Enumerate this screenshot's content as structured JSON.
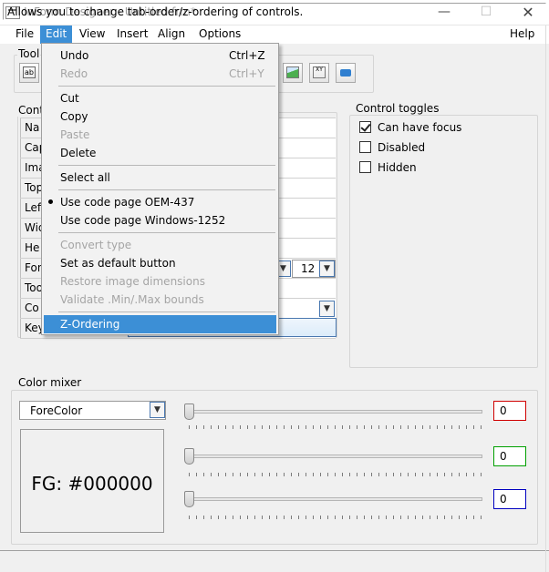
{
  "window": {
    "title": "InForm Designer - Untitled.frm*",
    "minimize_glyph": "—",
    "maximize_glyph": "☐",
    "close_glyph": "✕",
    "icon": "app-window-icon"
  },
  "menubar": [
    "File",
    "Edit",
    "View",
    "Insert",
    "Align",
    "Options",
    "Help"
  ],
  "toolbox": {
    "legend": "Tool",
    "label_tool_text": "ab",
    "frame_tool_text": "XY"
  },
  "control_props": {
    "legend": "Cont",
    "rows": [
      "Na",
      "Cap",
      "Ima",
      "Top",
      "Left",
      "Wid",
      "He",
      "Fon",
      "Too",
      "Co",
      "Key"
    ],
    "font_size": "12"
  },
  "control_toggles": {
    "legend": "Control toggles",
    "items": [
      {
        "label": "Can have focus",
        "checked": true
      },
      {
        "label": "Disabled",
        "checked": false
      },
      {
        "label": "Hidden",
        "checked": false
      }
    ]
  },
  "color_mixer": {
    "legend": "Color mixer",
    "target": "ForeColor",
    "preview": "FG: #000000",
    "red": "0",
    "green": "0",
    "blue": "0",
    "red_level": 0,
    "green_level": 0,
    "blue_level": 0,
    "colors": {
      "red": "#d00000",
      "green": "#00a000",
      "blue": "#0000c0"
    }
  },
  "edit_menu": {
    "items": [
      {
        "label": "Undo",
        "shortcut": "Ctrl+Z",
        "enabled": true
      },
      {
        "label": "Redo",
        "shortcut": "Ctrl+Y",
        "enabled": false
      },
      {
        "label": "Cut",
        "enabled": true
      },
      {
        "label": "Copy",
        "enabled": true
      },
      {
        "label": "Paste",
        "enabled": false
      },
      {
        "label": "Delete",
        "enabled": true
      },
      {
        "label": "Select all",
        "enabled": true
      },
      {
        "label": "Use code page OEM-437",
        "enabled": true,
        "checked": true
      },
      {
        "label": "Use code page Windows-1252",
        "enabled": true
      },
      {
        "label": "Convert type",
        "enabled": false
      },
      {
        "label": "Set as default button",
        "enabled": true
      },
      {
        "label": "Restore image dimensions",
        "enabled": false
      },
      {
        "label": "Validate .Min/.Max bounds",
        "enabled": false
      },
      {
        "label": "Z-Ordering",
        "enabled": true,
        "selected": true
      }
    ]
  },
  "status": "Allows you to change tab-order/z-ordering of controls.",
  "accent": "#3c8fd6"
}
